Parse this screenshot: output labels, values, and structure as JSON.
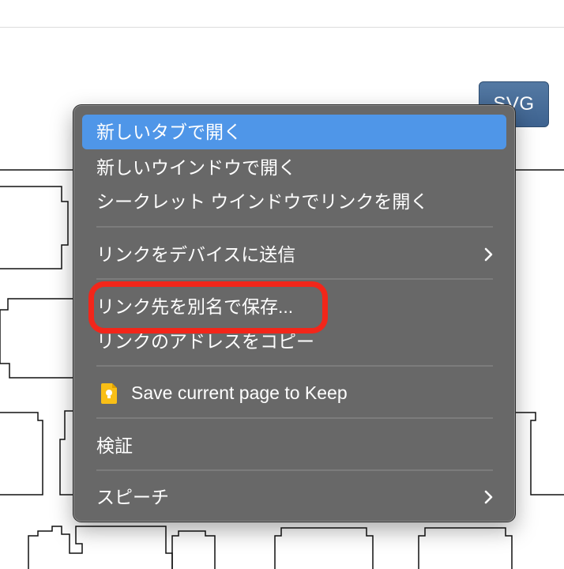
{
  "toolbar": {
    "svg_button_label": "SVG"
  },
  "context_menu": {
    "items": [
      {
        "label": "新しいタブで開く"
      },
      {
        "label": "新しいウインドウで開く"
      },
      {
        "label": "シークレット ウインドウでリンクを開く"
      },
      {
        "label": "リンクをデバイスに送信"
      },
      {
        "label": "リンク先を別名で保存..."
      },
      {
        "label": "リンクのアドレスをコピー"
      },
      {
        "label": "Save current page to Keep"
      },
      {
        "label": "検証"
      },
      {
        "label": "スピーチ"
      }
    ]
  },
  "colors": {
    "menu_background": "#686868",
    "selection": "#4f96e8",
    "highlight_ring": "#f2261a",
    "keep_icon": "#f9bf16",
    "svg_button": "#4a6f9b"
  },
  "icons": {
    "submenu": "chevron-right-icon",
    "keep": "keep-icon"
  }
}
